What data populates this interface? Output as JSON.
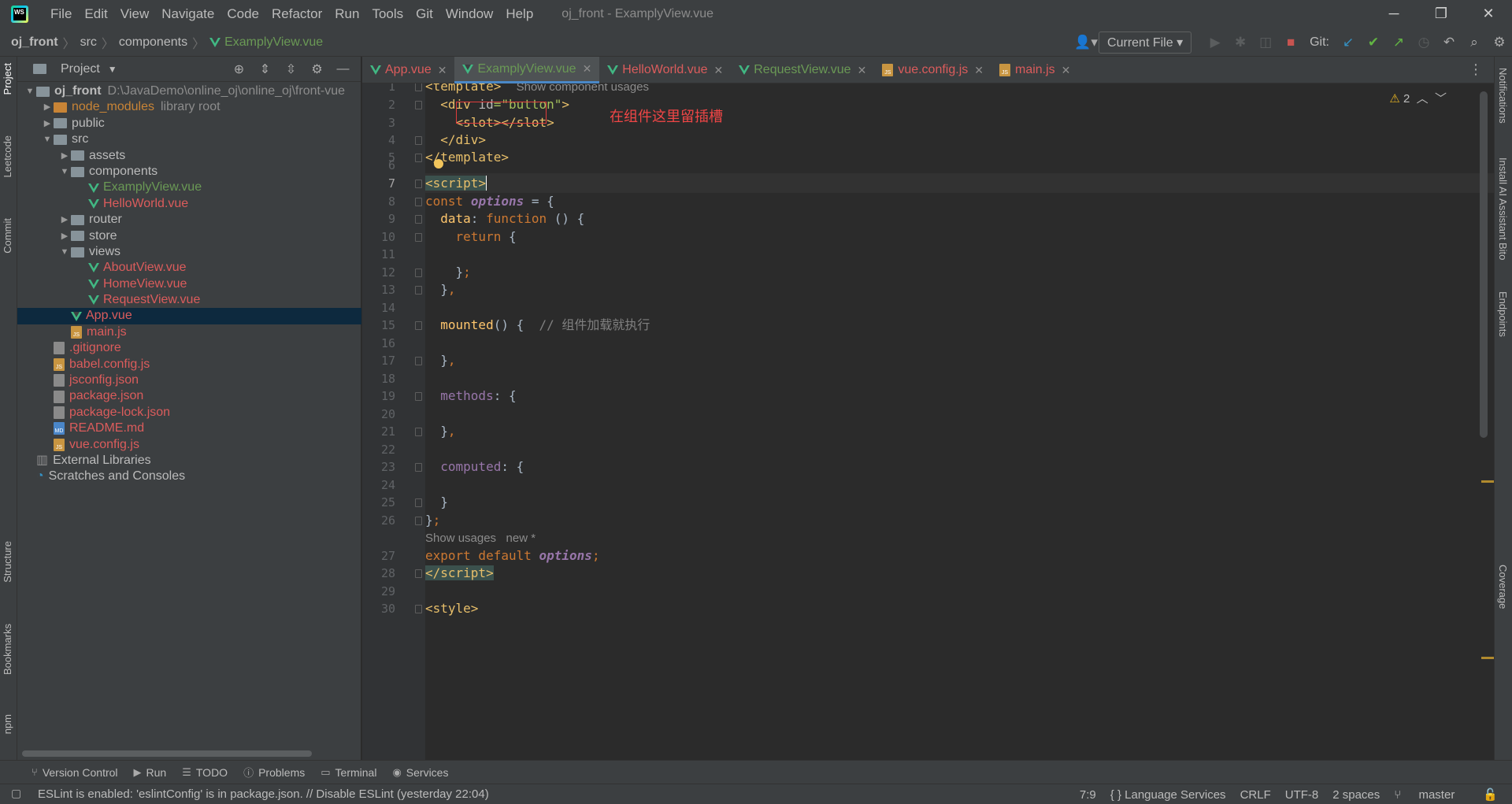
{
  "window": {
    "title": "oj_front - ExamplyView.vue",
    "minimize": "─",
    "restore": "❐",
    "close": "✕"
  },
  "menu": [
    "File",
    "Edit",
    "View",
    "Navigate",
    "Code",
    "Refactor",
    "Run",
    "Tools",
    "Git",
    "Window",
    "Help"
  ],
  "breadcrumb": {
    "project": "oj_front",
    "folder1": "src",
    "folder2": "components",
    "file": "ExamplyView.vue"
  },
  "toolbar": {
    "run_config": "Current File",
    "git_label": "Git:",
    "branch": "master"
  },
  "project_panel": {
    "title": "Project",
    "tree": [
      {
        "label": "oj_front",
        "extra": "D:\\JavaDemo\\online_oj\\online_oj\\front-vue",
        "depth": 0,
        "kind": "folder",
        "expanded": true,
        "color": "bold"
      },
      {
        "label": "node_modules",
        "extra": "library root",
        "depth": 1,
        "kind": "folder-orange",
        "expanded": false,
        "color": "orange"
      },
      {
        "label": "public",
        "depth": 1,
        "kind": "folder",
        "expanded": false,
        "color": "plain"
      },
      {
        "label": "src",
        "depth": 1,
        "kind": "folder",
        "expanded": true,
        "color": "plain"
      },
      {
        "label": "assets",
        "depth": 2,
        "kind": "folder",
        "expanded": false,
        "color": "plain"
      },
      {
        "label": "components",
        "depth": 2,
        "kind": "folder",
        "expanded": true,
        "color": "plain"
      },
      {
        "label": "ExamplyView.vue",
        "depth": 3,
        "kind": "vue",
        "color": "green"
      },
      {
        "label": "HelloWorld.vue",
        "depth": 3,
        "kind": "vue",
        "color": "red"
      },
      {
        "label": "router",
        "depth": 2,
        "kind": "folder",
        "expanded": false,
        "color": "plain"
      },
      {
        "label": "store",
        "depth": 2,
        "kind": "folder",
        "expanded": false,
        "color": "plain"
      },
      {
        "label": "views",
        "depth": 2,
        "kind": "folder",
        "expanded": true,
        "color": "plain"
      },
      {
        "label": "AboutView.vue",
        "depth": 3,
        "kind": "vue",
        "color": "red"
      },
      {
        "label": "HomeView.vue",
        "depth": 3,
        "kind": "vue",
        "color": "red"
      },
      {
        "label": "RequestView.vue",
        "depth": 3,
        "kind": "vue",
        "color": "red"
      },
      {
        "label": "App.vue",
        "depth": 2,
        "kind": "vue",
        "color": "red",
        "selected": true
      },
      {
        "label": "main.js",
        "depth": 2,
        "kind": "js",
        "color": "red"
      },
      {
        "label": ".gitignore",
        "depth": 1,
        "kind": "cfg",
        "color": "red"
      },
      {
        "label": "babel.config.js",
        "depth": 1,
        "kind": "js",
        "color": "red"
      },
      {
        "label": "jsconfig.json",
        "depth": 1,
        "kind": "cfg",
        "color": "red"
      },
      {
        "label": "package.json",
        "depth": 1,
        "kind": "cfg",
        "color": "red"
      },
      {
        "label": "package-lock.json",
        "depth": 1,
        "kind": "cfg",
        "color": "red"
      },
      {
        "label": "README.md",
        "depth": 1,
        "kind": "md",
        "color": "red"
      },
      {
        "label": "vue.config.js",
        "depth": 1,
        "kind": "js",
        "color": "red"
      },
      {
        "label": "External Libraries",
        "depth": 0,
        "kind": "lib",
        "color": "plain"
      },
      {
        "label": "Scratches and Consoles",
        "depth": 0,
        "kind": "scratch",
        "color": "plain"
      }
    ]
  },
  "tabs": [
    {
      "label": "App.vue",
      "kind": "vue",
      "color": "red",
      "active": false
    },
    {
      "label": "ExamplyView.vue",
      "kind": "vue",
      "color": "green",
      "active": true
    },
    {
      "label": "HelloWorld.vue",
      "kind": "vue",
      "color": "red",
      "active": false
    },
    {
      "label": "RequestView.vue",
      "kind": "vue",
      "color": "green",
      "active": false
    },
    {
      "label": "vue.config.js",
      "kind": "js",
      "color": "red",
      "active": false
    },
    {
      "label": "main.js",
      "kind": "js",
      "color": "red",
      "active": false
    }
  ],
  "editor": {
    "warnings": "2",
    "annotation": "在组件这里留插槽",
    "hint_line1": "Show component usages",
    "hint_usages": "Show usages   new *",
    "lines": [
      "1",
      "2",
      "3",
      "4",
      "5",
      "6",
      "7",
      "8",
      "9",
      "10",
      "11",
      "12",
      "13",
      "14",
      "15",
      "16",
      "17",
      "18",
      "19",
      "20",
      "21",
      "22",
      "23",
      "24",
      "25",
      "26",
      "27",
      "28",
      "29",
      "30"
    ],
    "current_line": "7",
    "comment_mounted": "// 组件加载就执行"
  },
  "left_stripe": [
    "Project",
    "Leetcode",
    "Commit",
    "Structure",
    "Bookmarks",
    "npm"
  ],
  "right_stripe": [
    "Notifications",
    "Install AI Assistant",
    "Bito",
    "Endpoints",
    "Coverage"
  ],
  "bottom_tabs": [
    "Version Control",
    "Run",
    "TODO",
    "Problems",
    "Terminal",
    "Services"
  ],
  "status": {
    "message": "ESLint is enabled: 'eslintConfig' is in package.json. // Disable ESLint (yesterday 22:04)",
    "position": "7:9",
    "lang": "{ } Language Services",
    "eol": "CRLF",
    "encoding": "UTF-8",
    "indent": "2 spaces",
    "branch": "master"
  }
}
